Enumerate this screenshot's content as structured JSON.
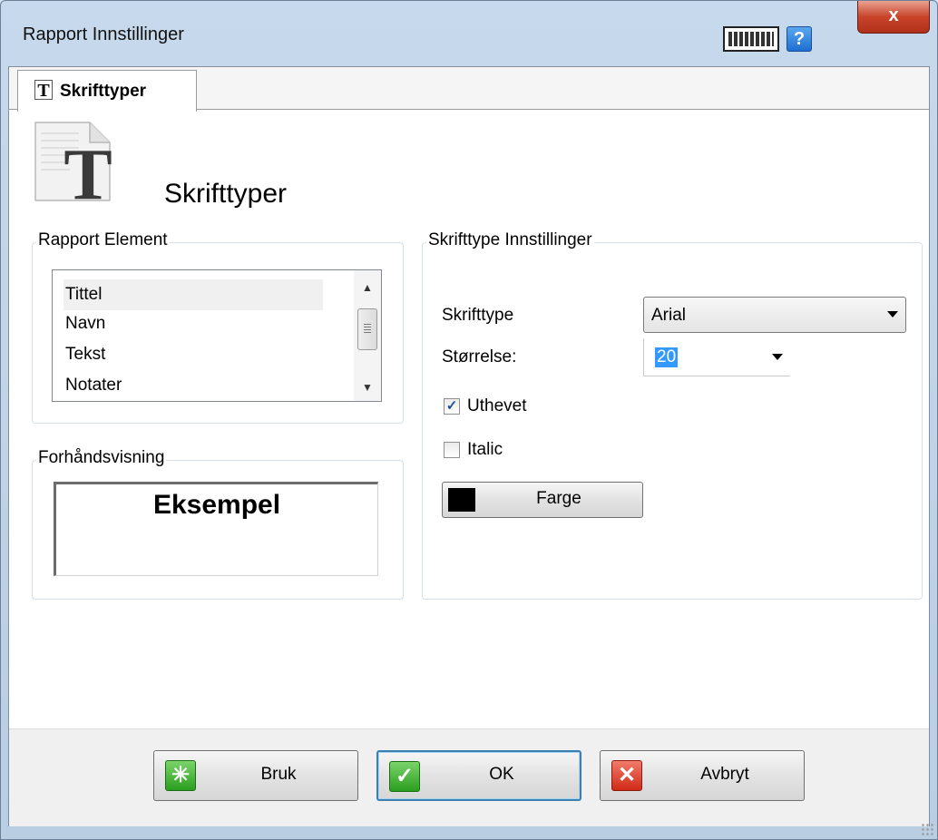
{
  "window": {
    "title": "Rapport Innstillinger",
    "keyboard_icon": "keyboard-icon",
    "help_label": "?",
    "close_label": "x"
  },
  "tabs": [
    {
      "label": "Skrifttyper",
      "icon": "font-icon",
      "active": true
    }
  ],
  "header": {
    "title": "Skrifttyper",
    "icon": "font-page-icon"
  },
  "rapport_element": {
    "label": "Rapport Element",
    "items": [
      "Tittel",
      "Navn",
      "Tekst",
      "Notater"
    ],
    "selected_index": 0
  },
  "preview": {
    "label": "Forhåndsvisning",
    "sample_text": "Eksempel"
  },
  "font_settings": {
    "label": "Skrifttype Innstillinger",
    "font_label": "Skrifttype",
    "font_value": "Arial",
    "size_label": "Størrelse:",
    "size_value": "20",
    "bold_label": "Uthevet",
    "bold_checked": true,
    "italic_label": "Italic",
    "italic_checked": false,
    "color_button_label": "Farge",
    "color_value": "#000000"
  },
  "footer": {
    "apply_label": "Bruk",
    "ok_label": "OK",
    "cancel_label": "Avbryt",
    "ok_check_glyph": "✓",
    "cancel_x_glyph": "✕",
    "apply_glyph": "✳"
  }
}
